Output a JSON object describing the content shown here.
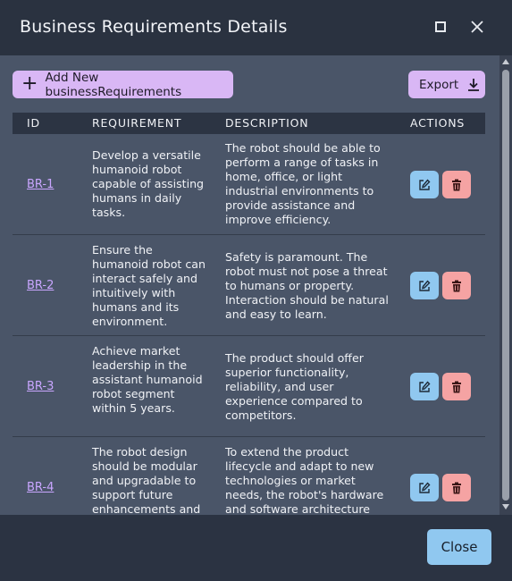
{
  "dialog": {
    "title": "Business Requirements Details",
    "maximize_icon": "square-icon",
    "close_icon": "x-icon"
  },
  "toolbar": {
    "add_label": "Add New businessRequirements",
    "add_icon": "plus-icon",
    "export_label": "Export",
    "export_icon": "download-icon"
  },
  "table": {
    "columns": [
      "ID",
      "REQUIREMENT",
      "DESCRIPTION",
      "ACTIONS"
    ],
    "rows": [
      {
        "id": "BR-1",
        "requirement": "Develop a versatile humanoid robot capable of assisting humans in daily tasks.",
        "description": "The robot should be able to perform a range of tasks in home, office, or light industrial environments to provide assistance and improve efficiency."
      },
      {
        "id": "BR-2",
        "requirement": "Ensure the humanoid robot can interact safely and intuitively with humans and its environment.",
        "description": "Safety is paramount. The robot must not pose a threat to humans or property. Interaction should be natural and easy to learn."
      },
      {
        "id": "BR-3",
        "requirement": "Achieve market leadership in the assistant humanoid robot segment within 5 years.",
        "description": "The product should offer superior functionality, reliability, and user experience compared to competitors."
      },
      {
        "id": "BR-4",
        "requirement": "The robot design should be modular and upgradable to support future enhancements and",
        "description": "To extend the product lifecycle and adapt to new technologies or market needs, the robot's hardware and software architecture"
      }
    ],
    "edit_icon": "pencil-square-icon",
    "delete_icon": "trash-icon"
  },
  "footer": {
    "close_label": "Close"
  },
  "colors": {
    "accent_purple": "#d9b7f5",
    "accent_blue": "#90c8f0",
    "danger_red": "#f5a3a3",
    "link_purple": "#c9a6ff"
  }
}
